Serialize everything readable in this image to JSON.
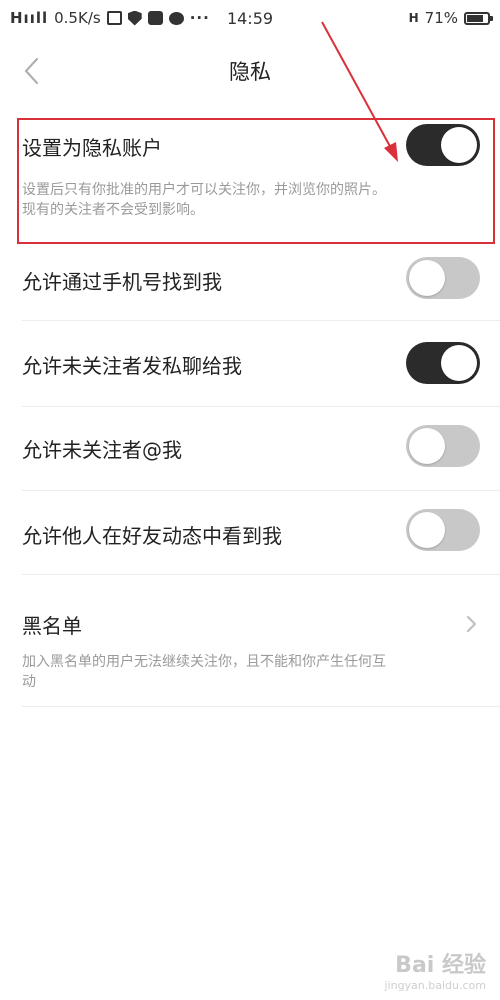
{
  "status_bar": {
    "network": "Hııll",
    "speed": "0.5K/s",
    "dots": "···",
    "time": "14:59",
    "signal_type": "H",
    "battery_text": "71%",
    "battery_level": 0.71
  },
  "header": {
    "title": "隐私"
  },
  "settings": [
    {
      "label": "设置为隐私账户",
      "desc": "设置后只有你批准的用户才可以关注你，并浏览你的照片。现有的关注者不会受到影响。",
      "on": true
    },
    {
      "label": "允许通过手机号找到我",
      "on": false
    },
    {
      "label": "允许未关注者发私聊给我",
      "on": true
    },
    {
      "label": "允许未关注者@我",
      "on": false
    },
    {
      "label": "允许他人在好友动态中看到我",
      "on": false
    }
  ],
  "blacklist": {
    "label": "黑名单",
    "desc": "加入黑名单的用户无法继续关注你，且不能和你产生任何互动"
  },
  "colors": {
    "toggle_on": "#2b2b2b",
    "toggle_off": "#c8c8c8",
    "annotation": "#d9303a"
  },
  "watermark": {
    "brand": "Bai 经验",
    "url": "jingyan.baidu.com"
  }
}
